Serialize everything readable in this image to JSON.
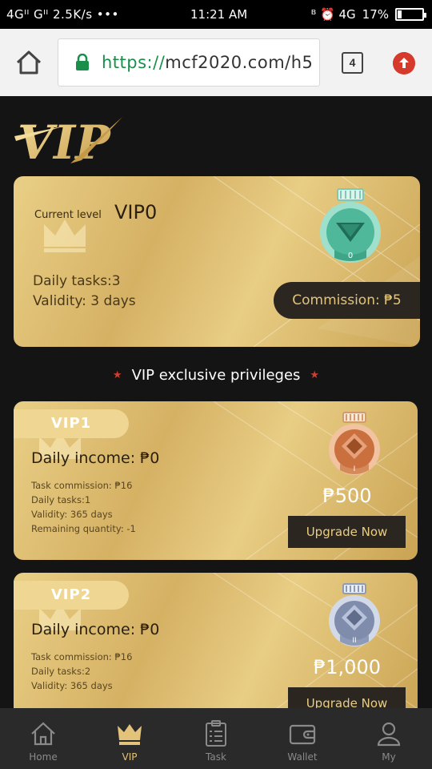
{
  "status_bar": {
    "left": "4Gᴵᴵ Gᴵᴵ 2.5K/s •••",
    "time": "11:21 AM",
    "right": "ᴮ ⏰ 4G",
    "battery": "17%",
    "battery_level": 0.17
  },
  "browser": {
    "url_scheme": "https://",
    "url_host": "mcf2020.com/h5",
    "tab_count": "4"
  },
  "header": {
    "logo_text": "VIP"
  },
  "current": {
    "label": "Current level",
    "level": "VIP0",
    "daily_tasks": "Daily tasks:3",
    "validity": "Validity: 3 days",
    "commission": "Commission: ₱5",
    "medal_number": "0"
  },
  "privileges_title": "VIP exclusive privileges",
  "tiers": [
    {
      "name": "VIP1",
      "daily_income": "Daily income: ₱0",
      "details": [
        "Task commission: ₱16",
        "Daily tasks:1",
        "Validity: 365 days",
        "Remaining quantity: -1"
      ],
      "price": "₱500",
      "button": "Upgrade Now",
      "medal_number": "I"
    },
    {
      "name": "VIP2",
      "daily_income": "Daily income: ₱0",
      "details": [
        "Task commission: ₱16",
        "Daily tasks:2",
        "Validity: 365 days"
      ],
      "price": "₱1,000",
      "button": "Upgrade Now",
      "medal_number": "II"
    }
  ],
  "nav": [
    {
      "label": "Home",
      "icon": "home-icon"
    },
    {
      "label": "VIP",
      "icon": "crown-icon"
    },
    {
      "label": "Task",
      "icon": "clipboard-icon"
    },
    {
      "label": "Wallet",
      "icon": "wallet-icon"
    },
    {
      "label": "My",
      "icon": "user-icon"
    }
  ],
  "colors": {
    "gold": "#d5b164",
    "dark": "#2b2620",
    "background": "#141414",
    "active_nav": "#e3c279",
    "secure_green": "#1a8f4b"
  }
}
